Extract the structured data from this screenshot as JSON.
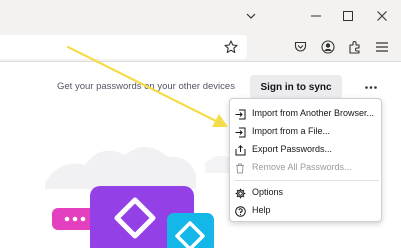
{
  "window_controls": {
    "icons": [
      "chevron-down-icon",
      "minimize-icon",
      "maximize-icon",
      "close-icon"
    ]
  },
  "toolbar": {
    "icons": [
      "bookmark-star-icon",
      "pocket-icon",
      "account-icon",
      "extensions-icon",
      "hamburger-menu-icon"
    ]
  },
  "sync_banner": {
    "text": "Get your passwords on your other devices",
    "button_label": "Sign in to sync",
    "more_icon": "more-options-icon"
  },
  "menu": {
    "items": [
      {
        "label": "Import from Another Browser...",
        "icon": "import-icon",
        "enabled": true
      },
      {
        "label": "Import from a File...",
        "icon": "import-icon",
        "enabled": true
      },
      {
        "label": "Export Passwords...",
        "icon": "export-icon",
        "enabled": true
      },
      {
        "label": "Remove All Passwords...",
        "icon": "trash-icon",
        "enabled": false
      },
      {
        "label": "Options",
        "icon": "gear-icon",
        "enabled": true
      },
      {
        "label": "Help",
        "icon": "help-icon",
        "enabled": true
      }
    ]
  },
  "colors": {
    "arrow": "#f5dc4d",
    "illustration_purple": "#9340e6",
    "illustration_blue": "#14b8e8",
    "illustration_pink": "#e43fbe"
  }
}
